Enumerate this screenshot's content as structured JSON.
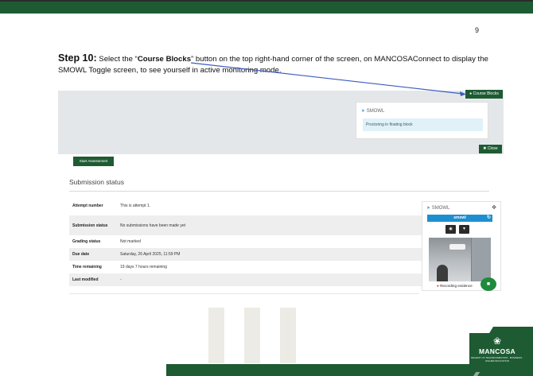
{
  "page_number": "9",
  "instruction": {
    "step_label": "Step 10:",
    "text_before": " Select the “",
    "bold_term": "Course Blocks",
    "text_after": "” button on the top right-hand corner of the screen, on MANCOSAConnect to display the SMOWL Toggle screen, to see yourself in active monitoring mode."
  },
  "screenshot": {
    "course_blocks_label": "Course Blocks",
    "smowl_block": {
      "title": "SMOWL",
      "message": "Proctoring in floating block"
    },
    "close_label": "Close",
    "start_assessment_label": "Start Assessment",
    "submission_title": "Submission status",
    "rows": [
      {
        "label": "Attempt number",
        "value": "This is attempt 1."
      },
      {
        "label": "Submission status",
        "value": "No submissions have been made yet"
      },
      {
        "label": "Grading status",
        "value": "Not marked"
      },
      {
        "label": "Due date",
        "value": "Saturday, 26 April 2025, 11:59 PM"
      },
      {
        "label": "Time remaining",
        "value": "19 days 7 hours remaining"
      },
      {
        "label": "Last modified",
        "value": "-"
      }
    ],
    "floating_panel": {
      "title": "SMOWL",
      "brand": "smowl",
      "recording_label": "Recording evidence"
    }
  },
  "logo": {
    "name": "MANCOSA",
    "tagline": "REGENT OF TRANSFORMATION · BUSINESS · HIGHER EDUCATION"
  },
  "colors": {
    "brand_green": "#1e5b33",
    "smowl_blue": "#1d8fd1",
    "arrow_blue": "#3a5bbf"
  }
}
